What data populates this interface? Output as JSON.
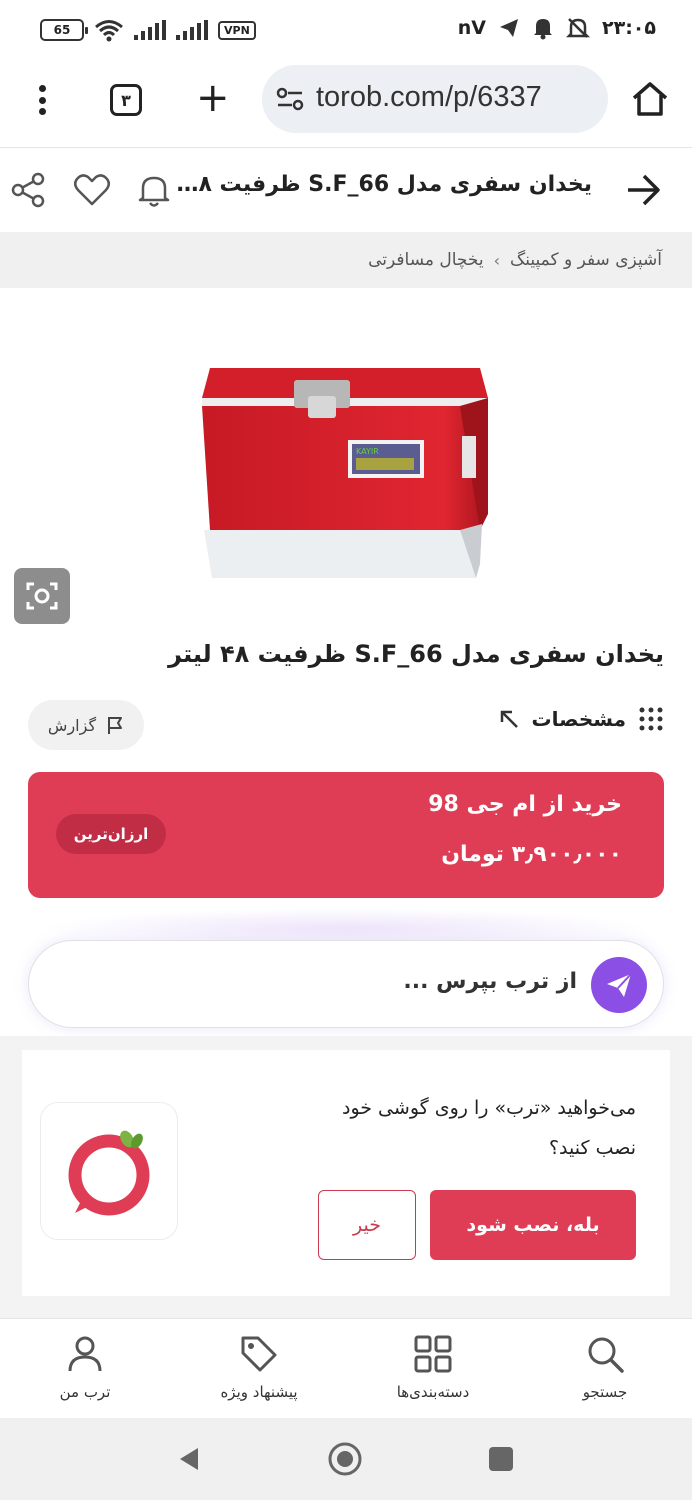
{
  "status_bar": {
    "battery_level": "65",
    "vpn_label": "VPN",
    "speed": "nV",
    "time": "۲۳:۰۵"
  },
  "browser": {
    "tab_count": "۳",
    "url": "torob.com/p/6337"
  },
  "header": {
    "title": "یخدان سفری مدل S.F_66 ظرفیت ۴۸ ..."
  },
  "breadcrumb": [
    "آشپزی سفر و کمپینگ",
    "یخچال مسافرتی"
  ],
  "breadcrumb_separator": "›",
  "product": {
    "title": "یخدان سفری مدل S.F_66 ظرفیت ۴۸ لیتر",
    "image_label": "KAYIR",
    "specs_label": "مشخصات",
    "report_label": "گزارش"
  },
  "offer": {
    "store_text": "خرید از ام جی 98",
    "price_text": "۳٫۹۰۰٫۰۰۰ تومان",
    "badge": "ارزان‌ترین"
  },
  "ask": {
    "placeholder": "از ترب بپرس ..."
  },
  "install_prompt": {
    "line1": "می‌خواهید «ترب» را روی گوشی خود",
    "line2": "نصب کنید؟",
    "yes_label": "بله، نصب شود",
    "no_label": "خیر"
  },
  "bottom_nav": [
    {
      "label": "جستجو",
      "icon": "search-icon"
    },
    {
      "label": "دسته‌بندی‌ها",
      "icon": "grid-icon"
    },
    {
      "label": "پیشنهاد ویژه",
      "icon": "tag-icon"
    },
    {
      "label": "ترب من",
      "icon": "user-icon"
    }
  ],
  "colors": {
    "accent_red": "#df3d55",
    "ask_purple": "#8c4fe6"
  }
}
